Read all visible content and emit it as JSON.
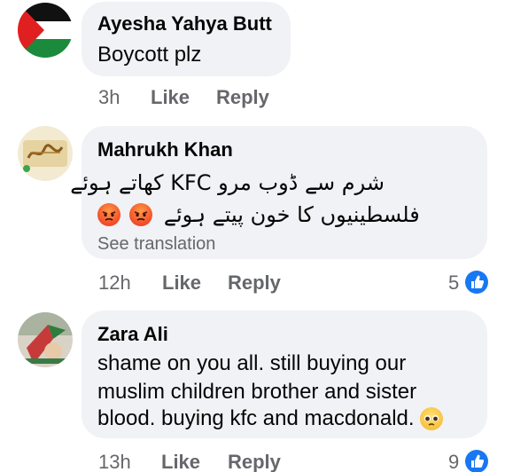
{
  "comments": [
    {
      "author": "Ayesha Yahya Butt",
      "text": "Boycott plz",
      "time": "3h",
      "like_label": "Like",
      "reply_label": "Reply"
    },
    {
      "author": "Mahrukh Khan",
      "text_line1": "شرم سے ڈوب مرو KFC کھاتے ہوئے",
      "text_line2": "فلسطینیوں کا خون پیتے ہوئے",
      "see_translation": "See translation",
      "time": "12h",
      "like_label": "Like",
      "reply_label": "Reply",
      "reaction_count": "5"
    },
    {
      "author": "Zara Ali",
      "text_line1": "shame on you all. still buying our",
      "text_line2": "muslim children brother and sister",
      "text_line3": "blood. buying kfc and macdonald.",
      "time": "13h",
      "like_label": "Like",
      "reply_label": "Reply",
      "reaction_count": "9"
    }
  ],
  "icons": {
    "like": "thumbs-up-icon",
    "angry": "angry-face-icon",
    "pleading": "pleading-face-icon"
  },
  "colors": {
    "bubble_bg": "#f0f2f5",
    "meta_text": "#65676b",
    "like_blue": "#1877f2"
  }
}
